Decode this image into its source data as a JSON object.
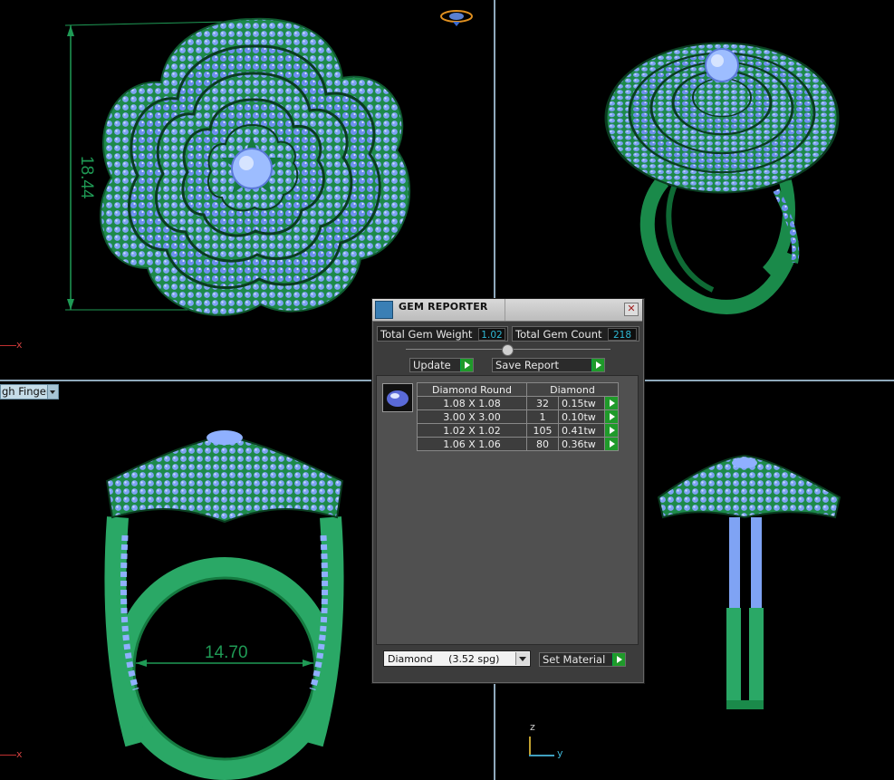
{
  "viewports": {
    "top_left": {
      "dimension": "18.44",
      "axis": "x"
    },
    "bottom_left": {
      "dimension": "14.70",
      "axis": "x",
      "view_selector": "gh Finger"
    },
    "bottom_right": {
      "axis_z": "z",
      "axis_y": "y"
    }
  },
  "gem_reporter": {
    "title": "GEM REPORTER",
    "close_glyph": "✕",
    "total_weight_label": "Total Gem Weight",
    "total_weight_value": "1.02",
    "total_count_label": "Total Gem Count",
    "total_count_value": "218",
    "update_label": "Update",
    "save_report_label": "Save Report",
    "table": {
      "headers": [
        "Diamond Round",
        "Diamond"
      ],
      "rows": [
        {
          "size": "1.08 X 1.08",
          "count": "32",
          "weight": "0.15tw"
        },
        {
          "size": "3.00 X 3.00",
          "count": "1",
          "weight": "0.10tw"
        },
        {
          "size": "1.02 X 1.02",
          "count": "105",
          "weight": "0.41tw"
        },
        {
          "size": "1.06 X 1.06",
          "count": "80",
          "weight": "0.36tw"
        }
      ]
    },
    "material_value": "Diamond     (3.52 spg)",
    "set_material_label": "Set Material"
  },
  "colors": {
    "metal": "#1f9a55",
    "gem": "#8fb0ff",
    "background": "#000000",
    "button_green": "#1f9a2a"
  }
}
